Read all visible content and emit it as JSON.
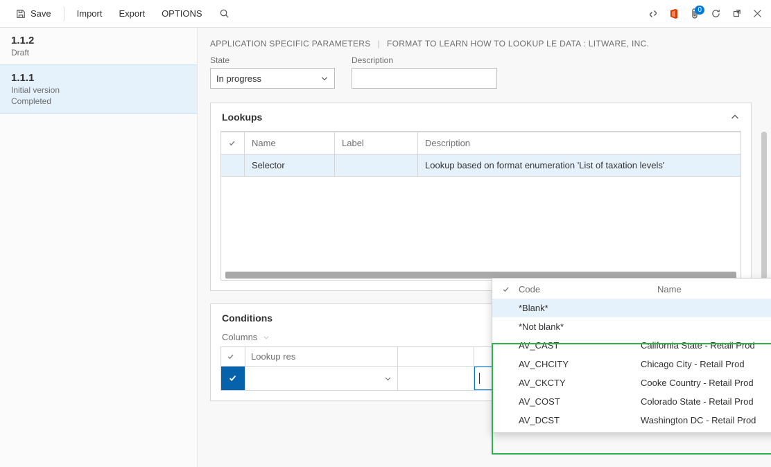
{
  "toolbar": {
    "save": "Save",
    "import": "Import",
    "export": "Export",
    "options": "OPTIONS",
    "badge_count": "0"
  },
  "sidebar": {
    "items": [
      {
        "version": "1.1.2",
        "line1": "Draft",
        "line2": ""
      },
      {
        "version": "1.1.1",
        "line1": "Initial version",
        "line2": "Completed"
      }
    ]
  },
  "breadcrumb": {
    "part1": "APPLICATION SPECIFIC PARAMETERS",
    "part2": "FORMAT TO LEARN HOW TO LOOKUP LE DATA : LITWARE, INC."
  },
  "header": {
    "state_label": "State",
    "state_value": "In progress",
    "description_label": "Description",
    "description_value": ""
  },
  "lookups": {
    "title": "Lookups",
    "columns": {
      "name": "Name",
      "label": "Label",
      "description": "Description"
    },
    "rows": [
      {
        "name": "Selector",
        "label": "",
        "description": "Lookup based on format enumeration 'List of taxation levels'"
      }
    ]
  },
  "conditions": {
    "title": "Conditions",
    "columns_btn": "Columns",
    "columns": {
      "lookup": "Lookup res"
    }
  },
  "dropdown": {
    "col_code": "Code",
    "col_name": "Name",
    "items": [
      {
        "code": "*Blank*",
        "name": ""
      },
      {
        "code": "*Not blank*",
        "name": ""
      },
      {
        "code": "AV_CAST",
        "name": "California State - Retail Prod"
      },
      {
        "code": "AV_CHCITY",
        "name": "Chicago City - Retail Prod"
      },
      {
        "code": "AV_CKCTY",
        "name": "Cooke Country - Retail Prod"
      },
      {
        "code": "AV_COST",
        "name": "Colorado State - Retail Prod"
      },
      {
        "code": "AV_DCST",
        "name": "Washington DC - Retail Prod"
      }
    ]
  }
}
